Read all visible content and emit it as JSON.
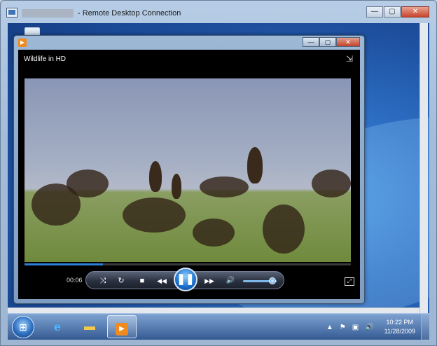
{
  "rdp": {
    "title": "- Remote Desktop Connection",
    "buttons": {
      "minimize": "—",
      "maximize": "▢",
      "close": "✕"
    }
  },
  "wmp": {
    "buttons": {
      "minimize": "—",
      "maximize": "▢",
      "close": "✕"
    },
    "now_playing_title": "Wildlife in HD",
    "elapsed": "00:06",
    "progress": 0.24,
    "volume": 0.88,
    "controls": {
      "shuffle": "⤨",
      "repeat": "↻",
      "stop": "■",
      "previous": "◀◀",
      "play_pause": "❚❚",
      "next": "▶▶",
      "mute": "🔊"
    }
  },
  "taskbar": {
    "start": "⊞",
    "ie": "e",
    "explorer": "▬",
    "wmp": "▶",
    "tray": {
      "up_arrow": "▲",
      "flag": "⚑",
      "network": "▣",
      "volume": "🔊"
    },
    "clock": {
      "time": "10:22 PM",
      "date": "11/28/2009"
    }
  },
  "colors": {
    "accent": "#2e7fd6",
    "wmp_orange": "#f08a1c",
    "close_red": "#c8442c"
  }
}
